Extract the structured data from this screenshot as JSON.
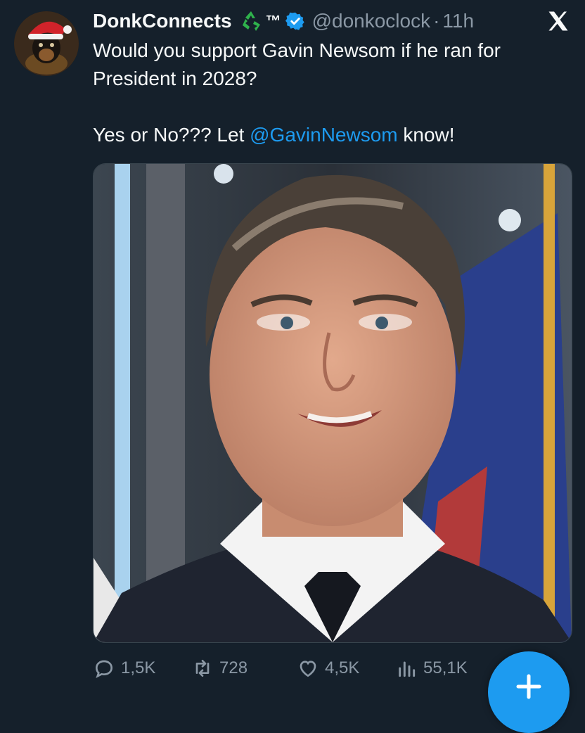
{
  "tweet": {
    "author": {
      "display_name": "DonkConnects",
      "tm": "™",
      "handle": "@donkoclock",
      "separator": "·",
      "time": "11h"
    },
    "text": {
      "line1": "Would you support Gavin Newsom if he ran for President in 2028?",
      "line2_prefix": "Yes or No??? Let ",
      "mention": "@GavinNewsom",
      "line2_suffix": " know!"
    },
    "stats": {
      "replies": "1,5K",
      "reposts": "728",
      "likes": "4,5K",
      "views": "55,1K"
    }
  },
  "colors": {
    "background": "#15202b",
    "text": "#f7f9f9",
    "secondary": "#8b98a5",
    "accent": "#1d9bf0"
  },
  "icons": {
    "recycle": "recycle-icon",
    "verified": "verified-badge-icon",
    "x_logo": "x-logo-icon",
    "reply": "reply-icon",
    "repost": "repost-icon",
    "like": "heart-icon",
    "views": "views-icon",
    "compose": "plus-icon"
  }
}
